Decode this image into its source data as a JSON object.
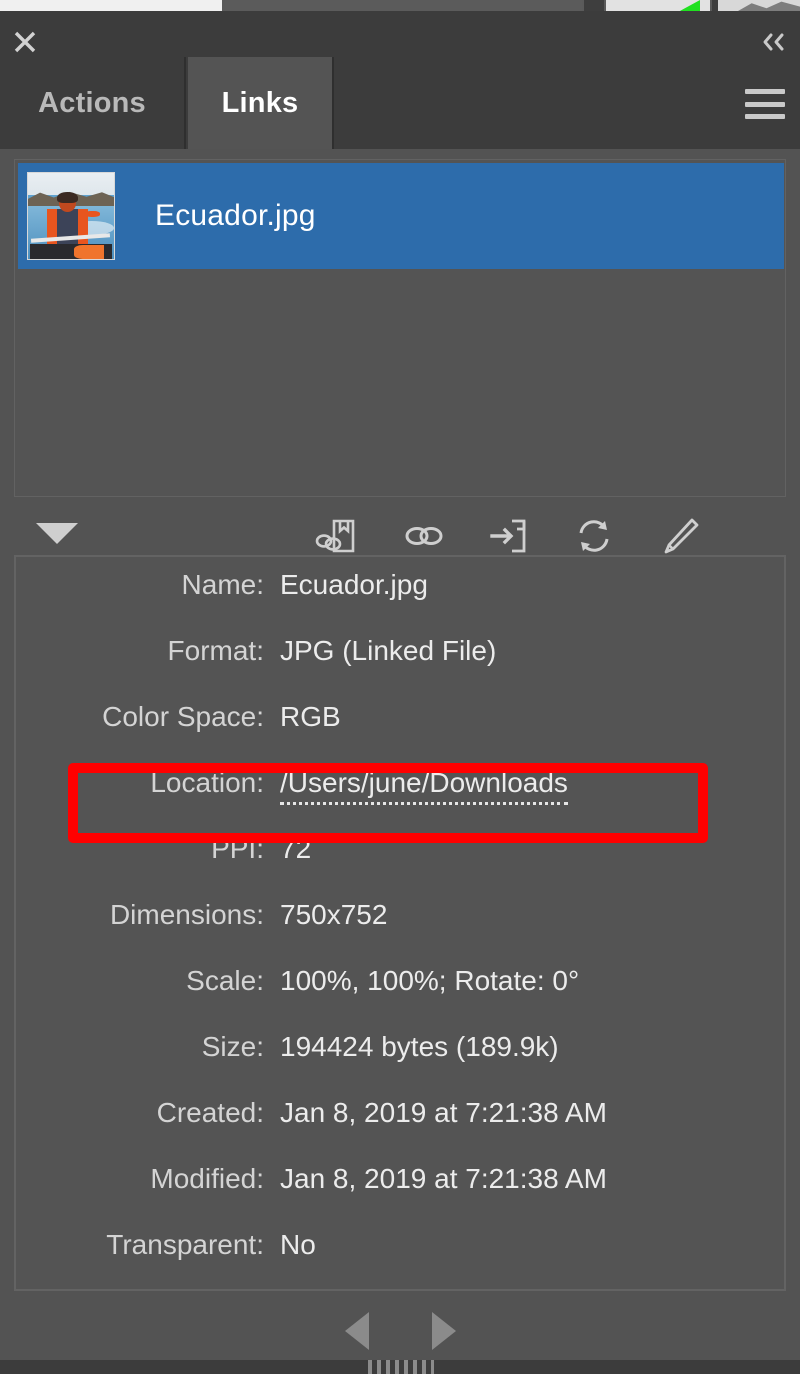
{
  "window": {
    "close_label": "close-window",
    "collapse_label": "collapse-to-icons"
  },
  "tabs": [
    {
      "label": "Actions",
      "active": false
    },
    {
      "label": "Links",
      "active": true
    }
  ],
  "panel_menu": {
    "label": "panel-menu"
  },
  "links_list": {
    "items": [
      {
        "name": "Ecuador.jpg",
        "selected": true
      }
    ]
  },
  "toolbar": {
    "disclosure_label": "Show/Hide Link Information",
    "buttons": [
      {
        "icon": "relink-from-library-icon",
        "label": "Relink From CC Libraries"
      },
      {
        "icon": "relink-icon",
        "label": "Relink"
      },
      {
        "icon": "go-to-link-icon",
        "label": "Go To Link"
      },
      {
        "icon": "update-link-icon",
        "label": "Update Link"
      },
      {
        "icon": "edit-original-icon",
        "label": "Edit Original"
      }
    ]
  },
  "link_info": {
    "rows": [
      {
        "label": "Name:",
        "value": "Ecuador.jpg",
        "linkified": false
      },
      {
        "label": "Format:",
        "value": "JPG (Linked File)",
        "linkified": false
      },
      {
        "label": "Color Space:",
        "value": "RGB",
        "linkified": false
      },
      {
        "label": "Location:",
        "value": "/Users/june/Downloads",
        "linkified": true
      },
      {
        "label": "PPI:",
        "value": "72",
        "linkified": false
      },
      {
        "label": "Dimensions:",
        "value": "750x752",
        "linkified": false
      },
      {
        "label": "Scale:",
        "value": "100%, 100%; Rotate: 0°",
        "linkified": false
      },
      {
        "label": "Size:",
        "value": "194424 bytes (189.9k)",
        "linkified": false
      },
      {
        "label": "Created:",
        "value": "Jan 8, 2019 at 7:21:38 AM",
        "linkified": false
      },
      {
        "label": "Modified:",
        "value": "Jan 8, 2019 at 7:21:38 AM",
        "linkified": false
      },
      {
        "label": "Transparent:",
        "value": "No",
        "linkified": false
      }
    ]
  },
  "annotation": {
    "target_row_label": "Location:",
    "color": "#ff0000"
  },
  "footer": {
    "prev_label": "Select Previous Link",
    "next_label": "Select Next Link"
  },
  "colors": {
    "panel_bg": "#535353",
    "titlebar_bg": "#3c3c3c",
    "tab_active_bg": "#545454",
    "tab_inactive_bg": "#3c3c3c",
    "selection_blue": "#2d6cab",
    "text_primary": "#ececec",
    "text_label": "#d4d4d4",
    "icon_gray": "#cfcfcf",
    "annotation_red": "#ff0000"
  }
}
